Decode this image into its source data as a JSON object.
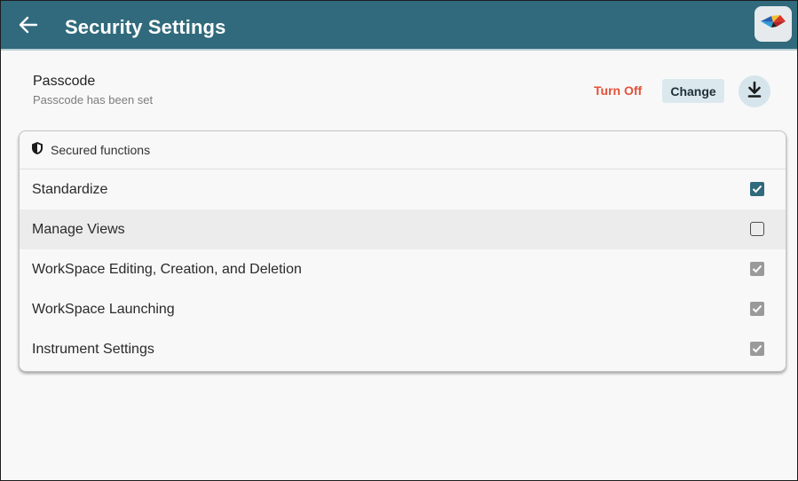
{
  "header": {
    "title": "Security Settings",
    "back_icon": "arrow-left-icon",
    "logo_icon": "app-logo-icon",
    "background_color": "#306a7c"
  },
  "passcode": {
    "title": "Passcode",
    "status": "Passcode has been set",
    "turn_off_label": "Turn Off",
    "change_label": "Change",
    "download_icon": "download-icon",
    "turn_off_color": "#e2513a"
  },
  "secured_functions": {
    "header_label": "Secured functions",
    "header_icon": "shield-icon",
    "items": [
      {
        "label": "Standardize",
        "checked": true,
        "disabled": false
      },
      {
        "label": "Manage Views",
        "checked": false,
        "disabled": false
      },
      {
        "label": "WorkSpace Editing, Creation, and Deletion",
        "checked": true,
        "disabled": true
      },
      {
        "label": "WorkSpace Launching",
        "checked": true,
        "disabled": true
      },
      {
        "label": "Instrument Settings",
        "checked": true,
        "disabled": true
      }
    ]
  }
}
